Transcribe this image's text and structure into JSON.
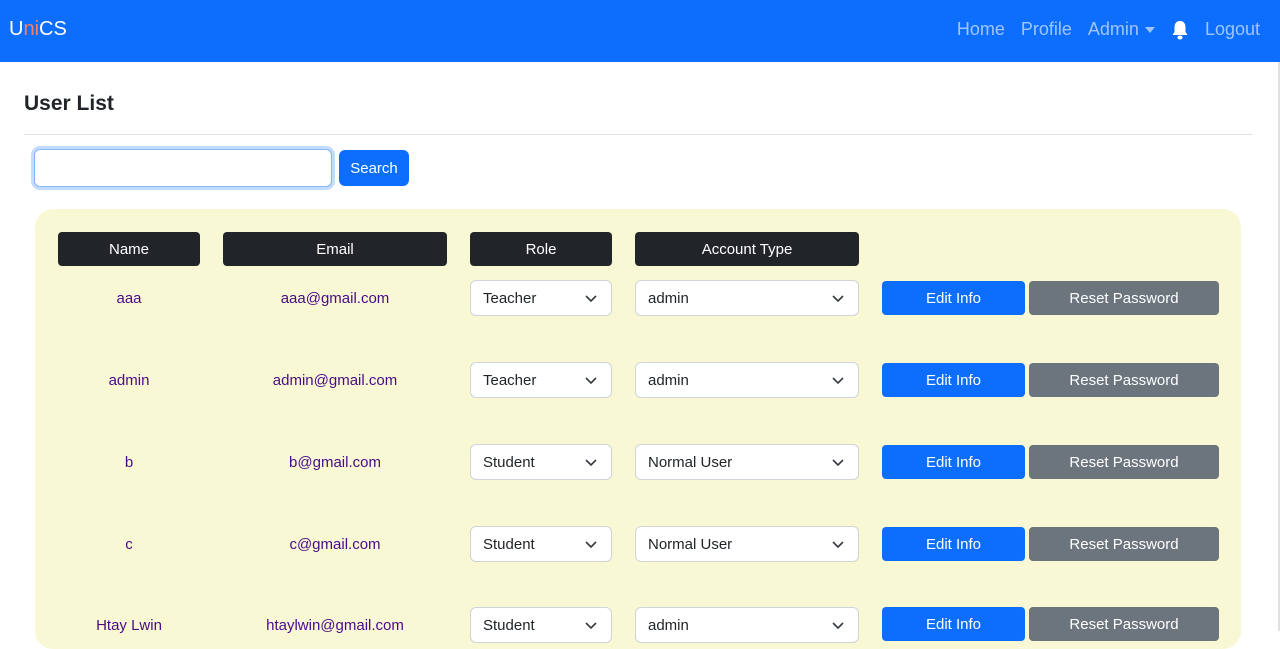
{
  "navbar": {
    "brand_u": "U",
    "brand_ni": "ni",
    "brand_cs": "CS",
    "links": {
      "home": "Home",
      "profile": "Profile",
      "admin": "Admin",
      "logout": "Logout"
    },
    "bell_icon": "bell-icon"
  },
  "page": {
    "title": "User List"
  },
  "search": {
    "value": "",
    "placeholder": "",
    "button_label": "Search"
  },
  "table": {
    "headers": {
      "name": "Name",
      "email": "Email",
      "role": "Role",
      "account_type": "Account Type"
    },
    "edit_label": "Edit Info",
    "reset_label": "Reset Password",
    "rows": [
      {
        "name": "aaa",
        "email": "aaa@gmail.com",
        "role": "Teacher",
        "account_type": "admin"
      },
      {
        "name": "admin",
        "email": "admin@gmail.com",
        "role": "Teacher",
        "account_type": "admin"
      },
      {
        "name": "b",
        "email": "b@gmail.com",
        "role": "Student",
        "account_type": "Normal User"
      },
      {
        "name": "c",
        "email": "c@gmail.com",
        "role": "Student",
        "account_type": "Normal User"
      },
      {
        "name": "Htay Lwin",
        "email": "htaylwin@gmail.com",
        "role": "Student",
        "account_type": "admin"
      }
    ]
  },
  "colors": {
    "primary": "#0d6efd",
    "secondary": "#6c757d",
    "header_dark": "#212529",
    "panel_bg": "#f8f8d4",
    "link_text": "#4b0a8a",
    "brand_accent": "#fd7e5a"
  }
}
